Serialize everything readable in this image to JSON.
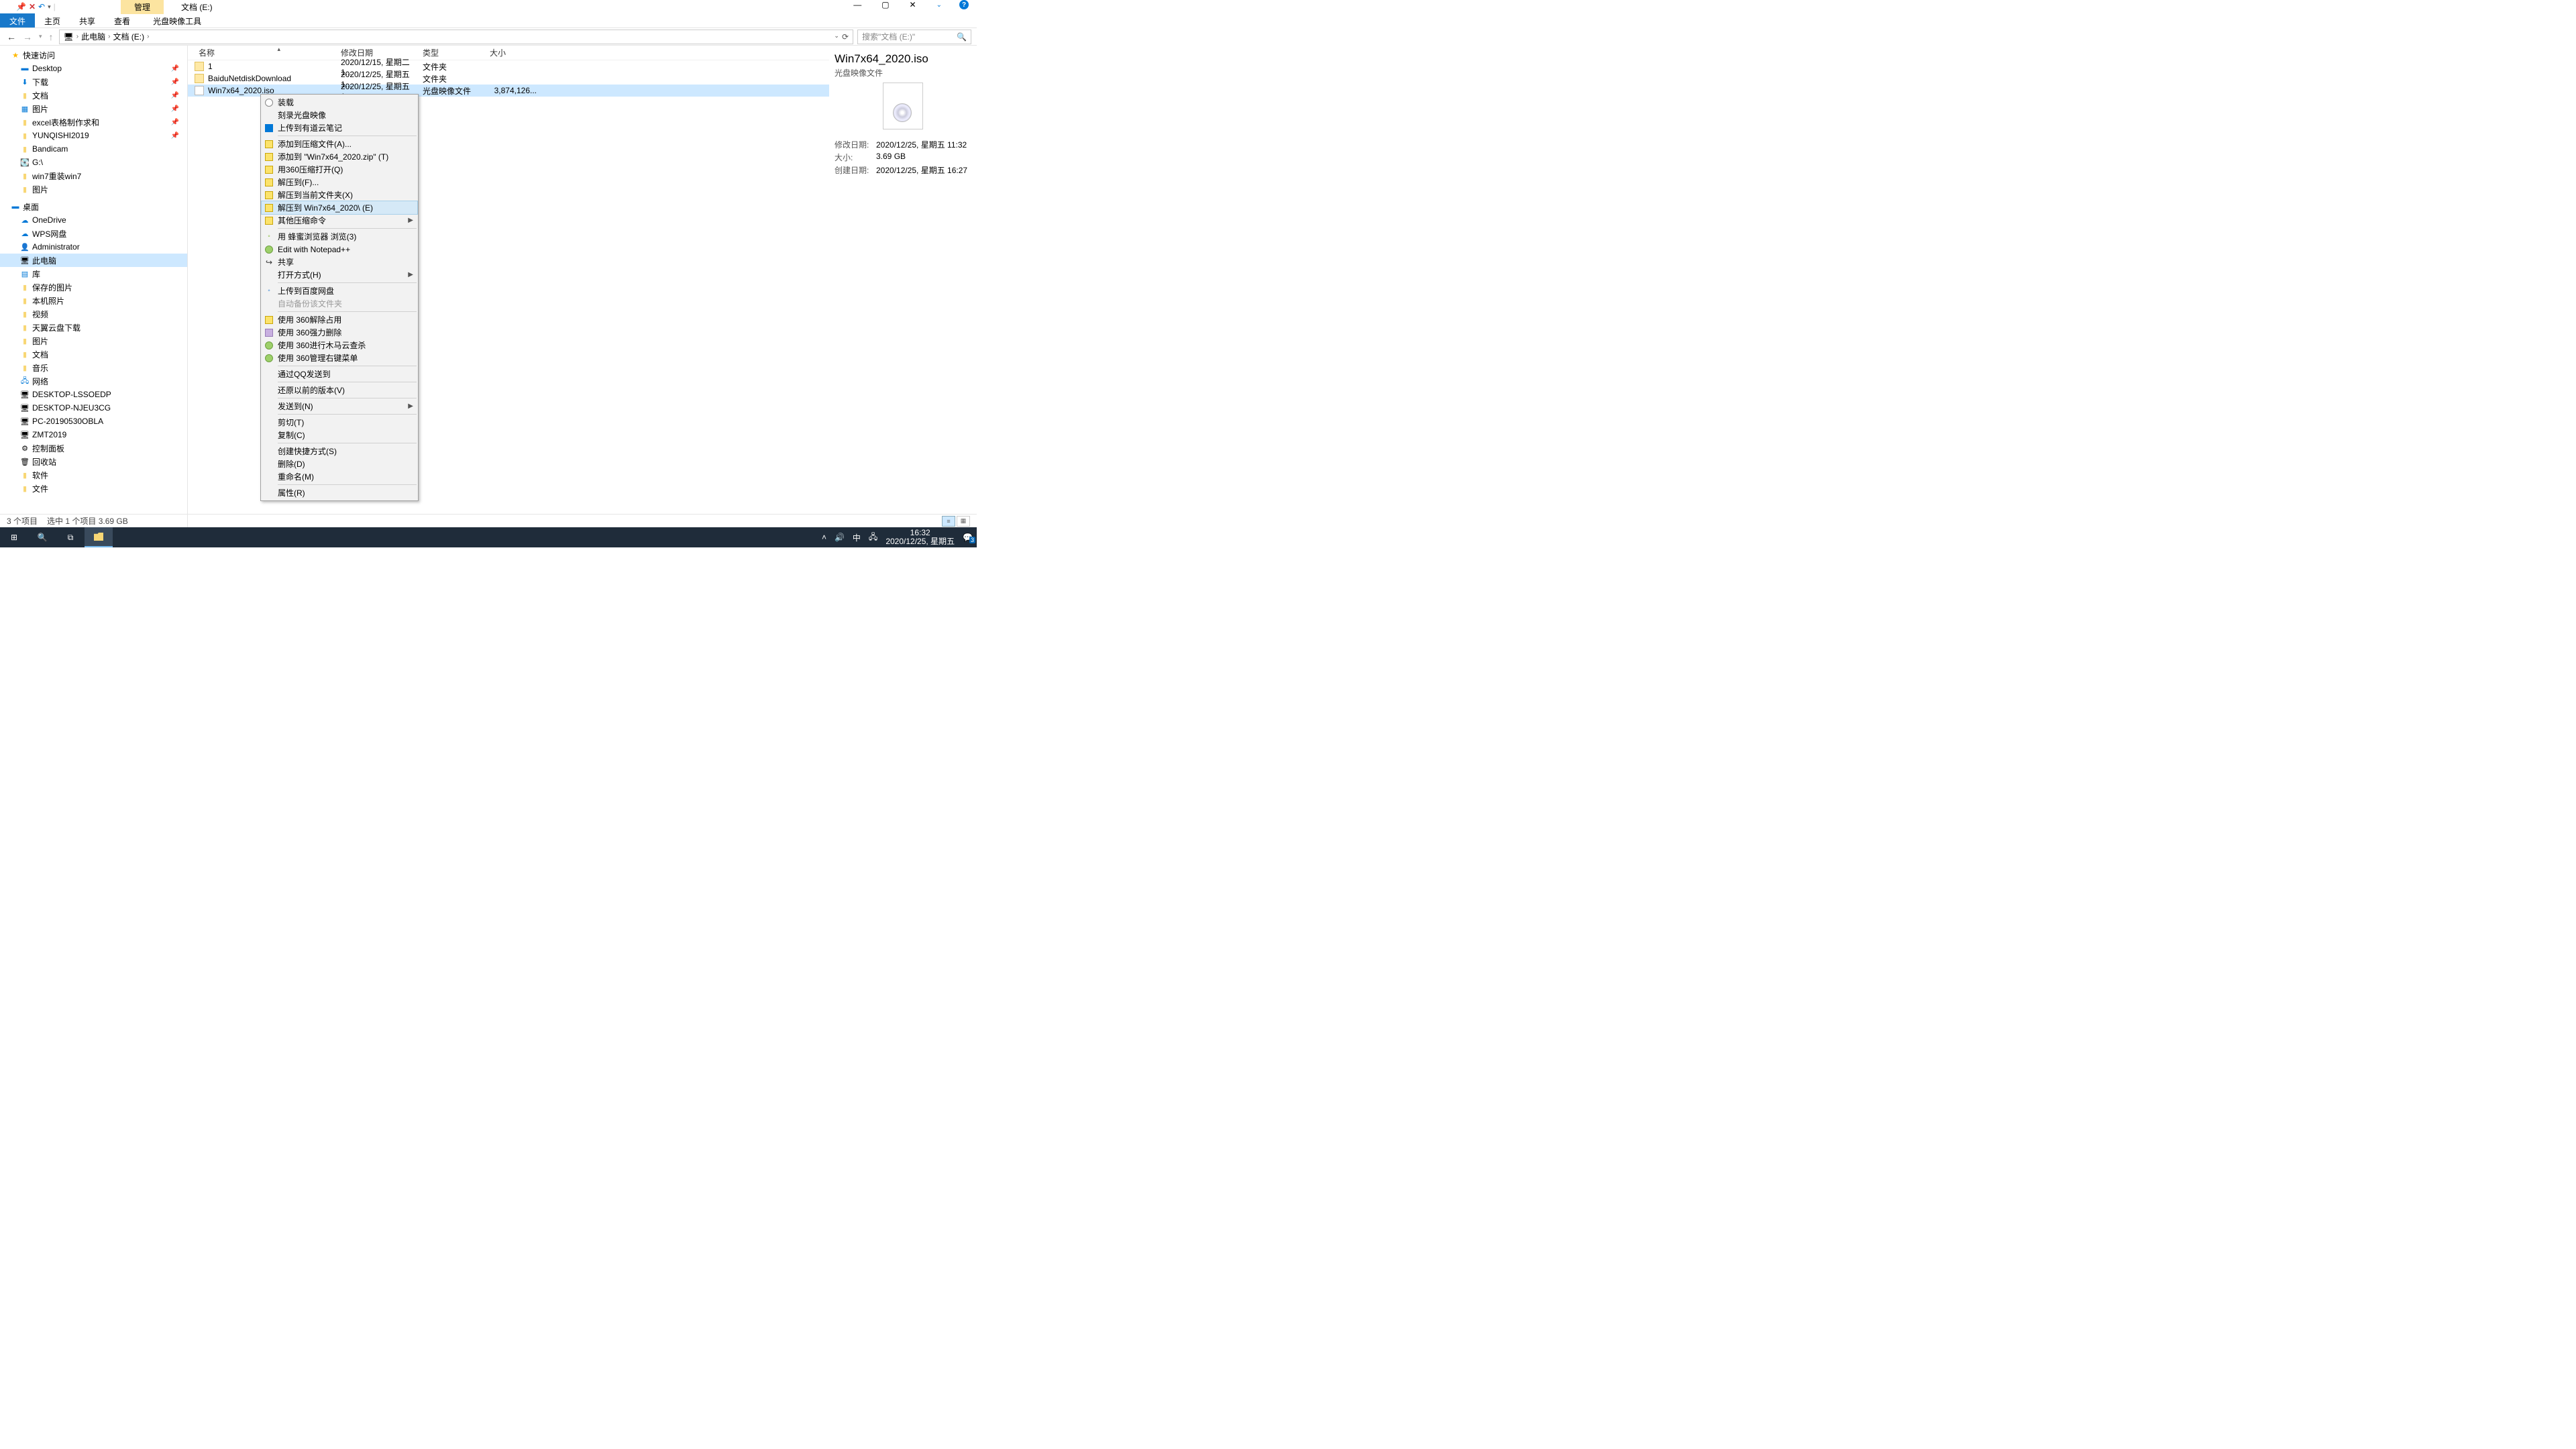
{
  "titlebar": {
    "context_tab": "管理",
    "window_title": "文档 (E:)"
  },
  "ribbon": {
    "file": "文件",
    "home": "主页",
    "share": "共享",
    "view": "查看",
    "iso_tools": "光盘映像工具"
  },
  "breadcrumb": {
    "root": "此电脑",
    "drive": "文档 (E:)"
  },
  "search_placeholder": "搜索\"文档 (E:)\"",
  "nav": {
    "quick_access": "快速访问",
    "desktop": "Desktop",
    "downloads": "下载",
    "documents": "文档",
    "pictures": "图片",
    "excel": "excel表格制作求和",
    "yunqishi": "YUNQISHI2019",
    "bandicam": "Bandicam",
    "g_drive": "G:\\",
    "win7reinstall": "win7重装win7",
    "pictures2": "图片",
    "desktop_root": "桌面",
    "onedrive": "OneDrive",
    "wps": "WPS网盘",
    "administrator": "Administrator",
    "this_pc": "此电脑",
    "libraries": "库",
    "saved_pics": "保存的图片",
    "local_pics": "本机照片",
    "videos": "视频",
    "tianyi": "天翼云盘下载",
    "pictures3": "图片",
    "docs_lib": "文档",
    "music": "音乐",
    "network": "网络",
    "net1": "DESKTOP-LSSOEDP",
    "net2": "DESKTOP-NJEU3CG",
    "net3": "PC-20190530OBLA",
    "net4": "ZMT2019",
    "control_panel": "控制面板",
    "recycle": "回收站",
    "software": "软件",
    "files": "文件"
  },
  "columns": {
    "name": "名称",
    "date": "修改日期",
    "type": "类型",
    "size": "大小"
  },
  "files": [
    {
      "name": "1",
      "date": "2020/12/15, 星期二 1...",
      "type": "文件夹",
      "size": "",
      "icon": "folder"
    },
    {
      "name": "BaiduNetdiskDownload",
      "date": "2020/12/25, 星期五 1...",
      "type": "文件夹",
      "size": "",
      "icon": "folder"
    },
    {
      "name": "Win7x64_2020.iso",
      "date": "2020/12/25, 星期五 1...",
      "type": "光盘映像文件",
      "size": "3,874,126...",
      "icon": "iso",
      "selected": true
    }
  ],
  "preview": {
    "title": "Win7x64_2020.iso",
    "subtitle": "光盘映像文件",
    "modified_label": "修改日期:",
    "modified": "2020/12/25, 星期五 11:32",
    "size_label": "大小:",
    "size": "3.69 GB",
    "created_label": "创建日期:",
    "created": "2020/12/25, 星期五 16:27"
  },
  "context_menu": [
    {
      "label": "装载",
      "icon": "circle"
    },
    {
      "label": "刻录光盘映像"
    },
    {
      "label": "上传到有道云笔记",
      "icon": "blue"
    },
    {
      "sep": true
    },
    {
      "label": "添加到压缩文件(A)...",
      "icon": "yel"
    },
    {
      "label": "添加到 \"Win7x64_2020.zip\" (T)",
      "icon": "yel"
    },
    {
      "label": "用360压缩打开(Q)",
      "icon": "yel"
    },
    {
      "label": "解压到(F)...",
      "icon": "yel"
    },
    {
      "label": "解压到当前文件夹(X)",
      "icon": "yel"
    },
    {
      "label": "解压到 Win7x64_2020\\ (E)",
      "icon": "yel",
      "hover": true
    },
    {
      "label": "其他压缩命令",
      "icon": "yel",
      "arrow": true
    },
    {
      "sep": true
    },
    {
      "label": "用 蜂蜜浏览器 浏览(3)",
      "icon": "grn-dot"
    },
    {
      "label": "Edit with Notepad++",
      "icon": "grn"
    },
    {
      "label": "共享",
      "icon": "share"
    },
    {
      "label": "打开方式(H)",
      "arrow": true
    },
    {
      "sep": true
    },
    {
      "label": "上传到百度网盘",
      "icon": "blue-dot"
    },
    {
      "label": "自动备份该文件夹",
      "disabled": true
    },
    {
      "sep": true
    },
    {
      "label": "使用 360解除占用",
      "icon": "yel"
    },
    {
      "label": "使用 360强力删除",
      "icon": "pur"
    },
    {
      "label": "使用 360进行木马云查杀",
      "icon": "grn"
    },
    {
      "label": "使用 360管理右键菜单",
      "icon": "grn"
    },
    {
      "sep": true
    },
    {
      "label": "通过QQ发送到"
    },
    {
      "sep": true
    },
    {
      "label": "还原以前的版本(V)"
    },
    {
      "sep": true
    },
    {
      "label": "发送到(N)",
      "arrow": true
    },
    {
      "sep": true
    },
    {
      "label": "剪切(T)"
    },
    {
      "label": "复制(C)"
    },
    {
      "sep": true
    },
    {
      "label": "创建快捷方式(S)"
    },
    {
      "label": "删除(D)"
    },
    {
      "label": "重命名(M)"
    },
    {
      "sep": true
    },
    {
      "label": "属性(R)"
    }
  ],
  "status": {
    "count": "3 个项目",
    "selection": "选中 1 个项目  3.69 GB"
  },
  "taskbar": {
    "ime": "中",
    "time": "16:32",
    "date": "2020/12/25, 星期五"
  }
}
